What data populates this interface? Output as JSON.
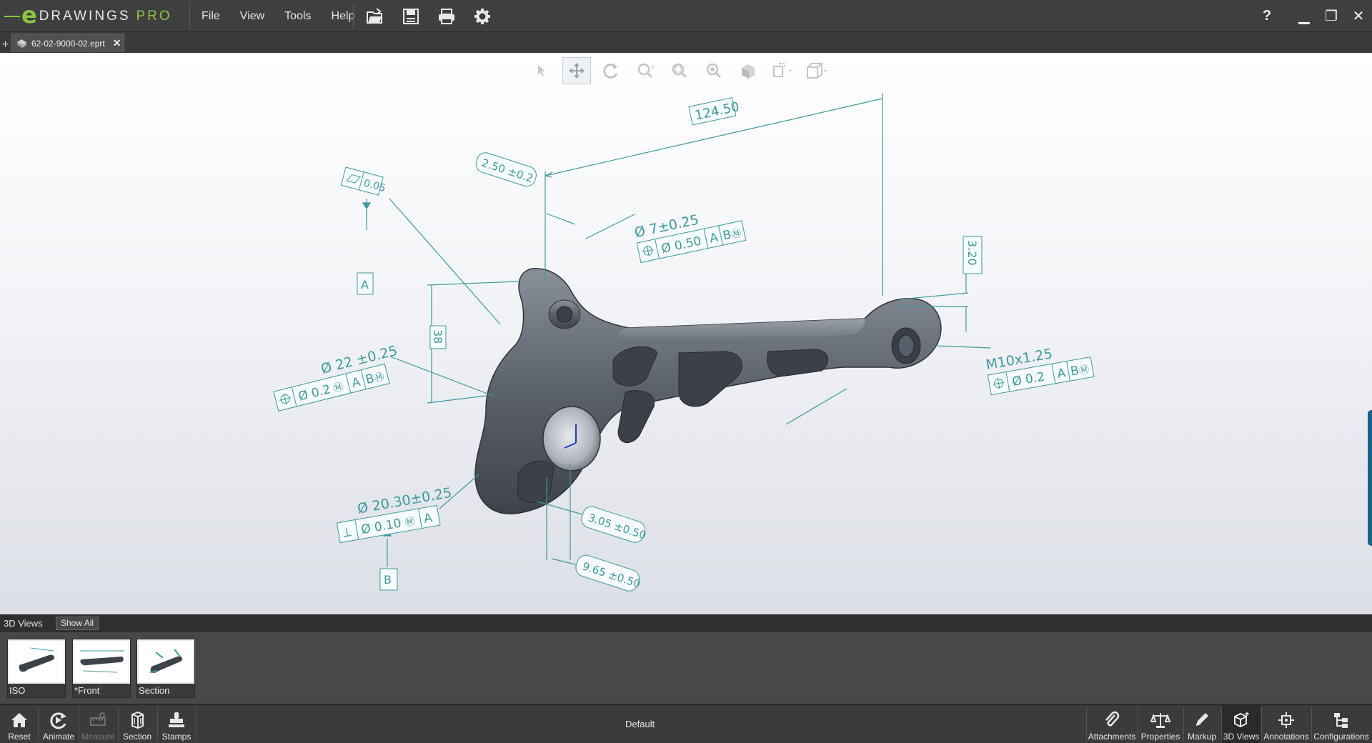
{
  "app": {
    "logo_mark": "e",
    "logo_text": "DRAWINGS",
    "logo_edition": "PRO"
  },
  "menu": {
    "items": [
      "File",
      "View",
      "Tools",
      "Help"
    ]
  },
  "toolbar": {
    "icons": [
      "open-file-icon",
      "save-icon",
      "print-icon",
      "settings-gear-icon"
    ]
  },
  "window": {
    "help": "?",
    "minimize": "▁",
    "restore": "❐",
    "close": "✕"
  },
  "tabs": {
    "new_tab": "+",
    "document": "62-02-9000-02.eprt",
    "close": "✕"
  },
  "viewport_toolbar": {
    "tools": [
      "select-icon",
      "pan-icon",
      "rotate-icon",
      "zoom-icon",
      "zoom-to-area-icon",
      "zoom-to-fit-icon",
      "view-orientation-icon",
      "display-style-icon",
      "view-cube-icon"
    ],
    "active_tool": "pan-icon"
  },
  "annotations": {
    "dim_124": "124.50",
    "dim_250": "2.50 ±0.2",
    "flatness_value": "0.05",
    "datum_a": "A",
    "dia7": "Ø 7±0.25",
    "fcf_dia7": [
      "Ø 0.50",
      "A",
      "B",
      "Ⓜ"
    ],
    "dim_320": "3.20",
    "dia22": "Ø 22 ±0.25",
    "fcf_dia22": [
      "Ø 0.2",
      "Ⓜ",
      "A",
      "B",
      "Ⓜ"
    ],
    "dim_38": "38",
    "m10": "M10x1.25",
    "fcf_m10": [
      "Ø 0.2",
      "A",
      "B",
      "Ⓜ"
    ],
    "dia2030": "Ø 20.30±0.25",
    "fcf_dia2030": [
      "⟂",
      "Ø 0.10",
      "Ⓜ",
      "A"
    ],
    "datum_b": "B",
    "dim_305": "3.05 ±0.50",
    "dim_965": "9.65 ±0.50"
  },
  "views_panel": {
    "title": "3D Views",
    "show_all": "Show All",
    "thumbnails": [
      {
        "label": "ISO"
      },
      {
        "label": "*Front"
      },
      {
        "label": "Section"
      }
    ]
  },
  "bottom": {
    "left_buttons": [
      {
        "label": "Reset",
        "icon": "home-icon",
        "enabled": true
      },
      {
        "label": "Animate",
        "icon": "animate-icon",
        "enabled": true
      },
      {
        "label": "Measure",
        "icon": "measure-icon",
        "enabled": false
      },
      {
        "label": "Section",
        "icon": "section-icon",
        "enabled": true
      },
      {
        "label": "Stamps",
        "icon": "stamp-icon",
        "enabled": true
      }
    ],
    "configuration": "Default",
    "right_buttons": [
      {
        "label": "Attachments",
        "icon": "paperclip-icon"
      },
      {
        "label": "Properties",
        "icon": "scale-icon"
      },
      {
        "label": "Markup",
        "icon": "pencil-icon"
      },
      {
        "label": "3D Views",
        "icon": "3d-views-icon"
      },
      {
        "label": "Annotations",
        "icon": "annotations-icon"
      },
      {
        "label": "Configurations",
        "icon": "configurations-icon"
      }
    ],
    "active_right": "3D Views"
  },
  "colors": {
    "accent_green": "#8cc63f",
    "annotation_teal": "#3a9b9b",
    "part_gray": "#5b616b"
  }
}
